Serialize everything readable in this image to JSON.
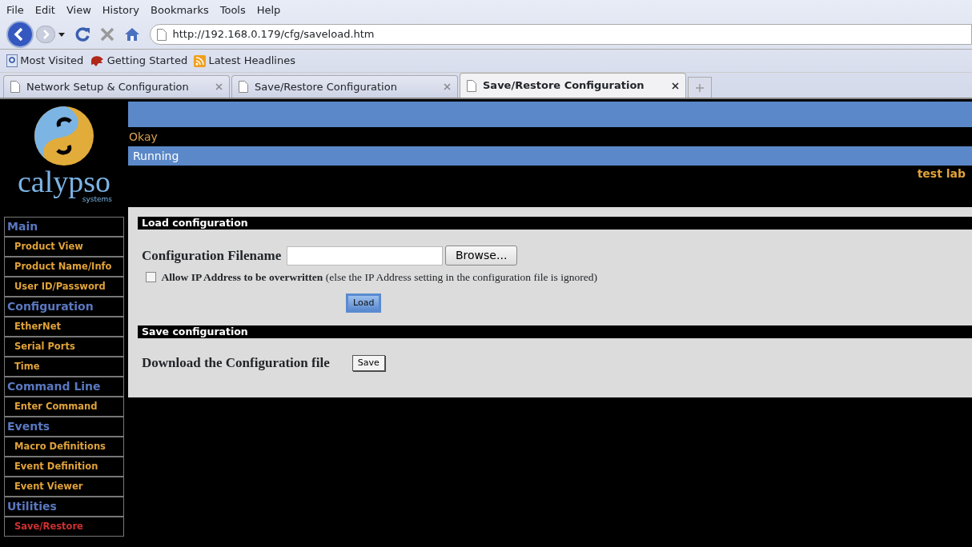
{
  "menu_bar": [
    "File",
    "Edit",
    "View",
    "History",
    "Bookmarks",
    "Tools",
    "Help"
  ],
  "address_bar": {
    "url": "http://192.168.0.179/cfg/saveload.htm"
  },
  "bookmarks": [
    "Most Visited",
    "Getting Started",
    "Latest Headlines"
  ],
  "tabs": [
    {
      "label": "Network Setup & Configuration",
      "selected": false
    },
    {
      "label": "Save/Restore Configuration",
      "selected": false
    },
    {
      "label": "Save/Restore Configuration",
      "selected": true
    }
  ],
  "logo": {
    "name": "calypso",
    "tagline": "systems"
  },
  "status": {
    "state": "Okay",
    "mode": "Running",
    "location": "test lab"
  },
  "sidebar": {
    "items": [
      {
        "kind": "header",
        "label": "Main",
        "selected": false
      },
      {
        "kind": "link",
        "label": "Product View",
        "selected": false
      },
      {
        "kind": "link",
        "label": "Product Name/Info",
        "selected": false
      },
      {
        "kind": "link",
        "label": "User ID/Password",
        "selected": false
      },
      {
        "kind": "header",
        "label": "Configuration",
        "selected": false
      },
      {
        "kind": "link",
        "label": "EtherNet",
        "selected": false
      },
      {
        "kind": "link",
        "label": "Serial Ports",
        "selected": false
      },
      {
        "kind": "link",
        "label": "Time",
        "selected": false
      },
      {
        "kind": "header",
        "label": "Command Line",
        "selected": false
      },
      {
        "kind": "link",
        "label": "Enter Command",
        "selected": false
      },
      {
        "kind": "header",
        "label": "Events",
        "selected": false
      },
      {
        "kind": "link",
        "label": "Macro Definitions",
        "selected": false
      },
      {
        "kind": "link",
        "label": "Event Definition",
        "selected": false
      },
      {
        "kind": "link",
        "label": "Event Viewer",
        "selected": false
      },
      {
        "kind": "header",
        "label": "Utilities",
        "selected": false
      },
      {
        "kind": "link",
        "label": "Save/Restore",
        "selected": true
      }
    ]
  },
  "load_section": {
    "title": "Load configuration",
    "filename_label": "Configuration Filename",
    "browse_button": "Browse...",
    "checkbox": {
      "label": "**Allow IP Address to be overwritten** (else the IP Address setting in the configuration file is ignored)",
      "checked": false
    },
    "load_button": "Load"
  },
  "save_section": {
    "title": "Save configuration",
    "label": "Download the Configuration file",
    "save_button": "Save"
  }
}
